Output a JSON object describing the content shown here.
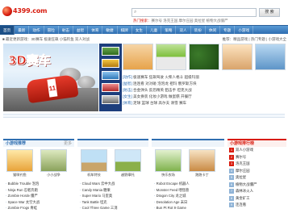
{
  "header": {
    "logo_text": "4399.com",
    "search_placeholder": "",
    "search_button": "搜 索",
    "hot_label": "热门搜索：",
    "hot_terms": "赛尔号 洛克王国 摩尔庄园 奥拉星 植物大战僵尸"
  },
  "nav": {
    "items": [
      "首页",
      "最新",
      "动作",
      "冒险",
      "射击",
      "益智",
      "体育",
      "敏捷",
      "棋牌",
      "女生",
      "儿童",
      "策略",
      "双人",
      "装扮",
      "休闲",
      "专题",
      "小游戏",
      "排行",
      "合集"
    ]
  },
  "subbar": {
    "text": "■ 最近更新游戏：3D赛车 极速狂飙 小猫钓鱼 双人对战"
  },
  "feature_bar": {
    "text": "推荐：精品游戏 | 热门专题 | 小游戏大全"
  },
  "hero": {
    "title": "3D赛车",
    "car_number": "11"
  },
  "news": {
    "rows": [
      {
        "cat": "[动作]",
        "text": "极速赛车 狂飙驾驶 火柴人格斗 超级玛丽"
      },
      {
        "cat": "[益智]",
        "text": "连连看 对对碰 泡泡龙 祖玛 俄罗斯方块"
      },
      {
        "cat": "[射击]",
        "text": "合金弹头 反恐精英 狙击手 坦克大战"
      },
      {
        "cat": "[女生]",
        "text": "美女换装 化妆小游戏 做蛋糕 开餐厅"
      },
      {
        "cat": "[体育]",
        "text": "足球 篮球 台球 高尔夫 滑雪 赛车"
      }
    ]
  },
  "sections": [
    {
      "title": "小游戏推荐",
      "more": "更多",
      "games": [
        {
          "caption": "猫咪钓鱼"
        },
        {
          "caption": "小小战争"
        }
      ],
      "list": [
        {
          "b": "·",
          "t": "Bubble Trouble 泡泡"
        },
        {
          "b": "·",
          "t": "Ninja Run 忍者奔跑"
        },
        {
          "b": "·",
          "t": "Zombie Horde 僵尸"
        },
        {
          "b": "·",
          "t": "Space War 太空大战"
        },
        {
          "b": "·",
          "t": "Zombie Frogs 青蛙"
        }
      ]
    },
    {
      "title": "",
      "more": "",
      "games": [
        {
          "caption": "机车特技"
        },
        {
          "caption": "越野摩托"
        }
      ],
      "list": [
        {
          "b": "·",
          "t": "Cloud Wars 云中大战"
        },
        {
          "b": "·",
          "t": "Candy Mania 糖果"
        },
        {
          "b": "·",
          "t": "Super Mario 马里奥"
        },
        {
          "b": "·",
          "t": "Tank Battle 坦克"
        },
        {
          "b": "·",
          "t": "Cool Three Game 三消"
        }
      ]
    },
    {
      "title": "",
      "more": "",
      "games": [
        {
          "caption": "快乐农场"
        },
        {
          "caption": "跑跑卡丁"
        }
      ],
      "list": [
        {
          "b": "·",
          "t": "Robot Escape 机器人"
        },
        {
          "b": "·",
          "t": "Monster Feed 喂怪兽"
        },
        {
          "b": "·",
          "t": "Dragon City 龙之城"
        },
        {
          "b": "·",
          "t": "Desolation Age 末日"
        },
        {
          "b": "·",
          "t": "Bun Pt Rot 9 Game"
        }
      ]
    }
  ],
  "rank": {
    "title": "小游戏排行榜",
    "items": [
      "双人小游戏",
      "赛尔号",
      "洛克王国",
      "摩尔庄园",
      "奥拉星",
      "植物大战僵尸",
      "森林冰火人",
      "黄金矿工",
      "连连看"
    ]
  },
  "colors": {
    "brand": "#d81b0e",
    "nav": "#2f6eb0"
  }
}
